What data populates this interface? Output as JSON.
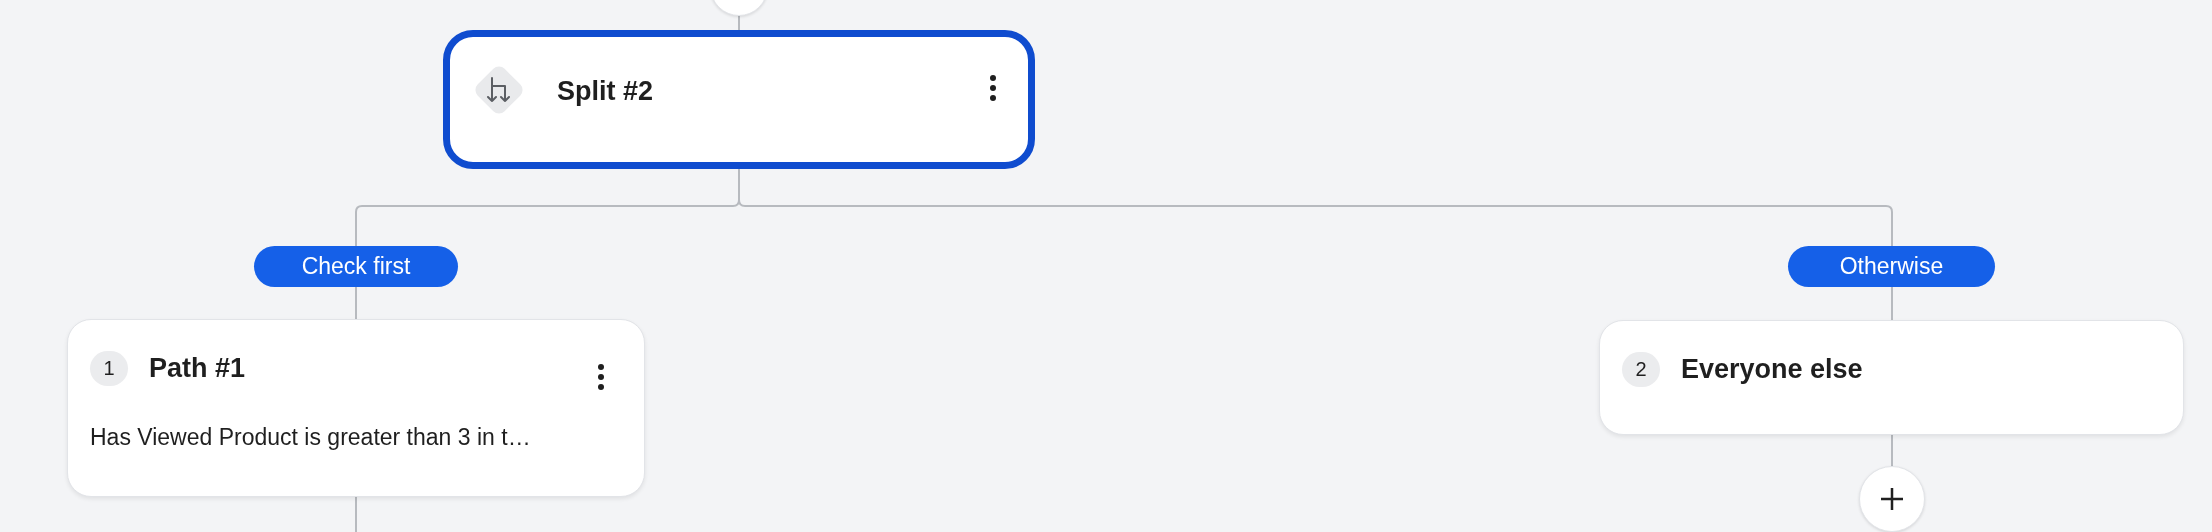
{
  "split": {
    "title": "Split #2",
    "selected": true
  },
  "branches": [
    {
      "label": "Check first",
      "number": "1",
      "title": "Path #1",
      "description": "Has Viewed Product is greater than 3 in t…",
      "menu": true,
      "add_button": false
    },
    {
      "label": "Otherwise",
      "number": "2",
      "title": "Everyone else",
      "menu": false,
      "add_button": true
    }
  ]
}
